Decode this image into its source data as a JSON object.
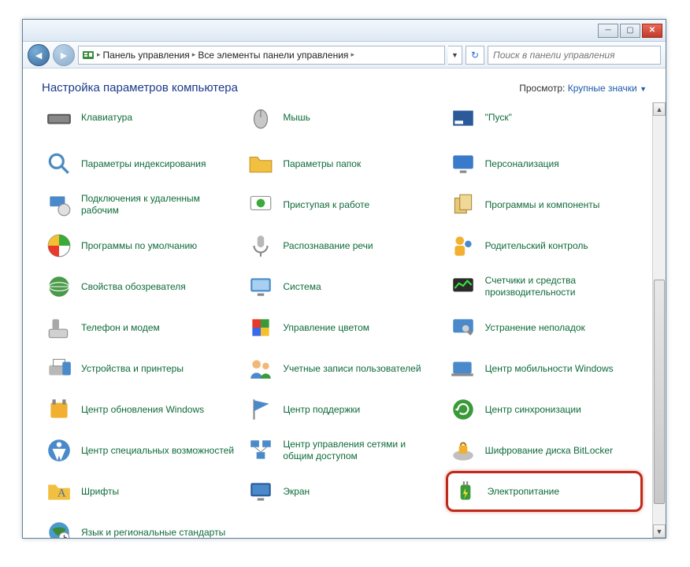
{
  "breadcrumb": {
    "root": "Панель управления",
    "current": "Все элементы панели управления"
  },
  "search": {
    "placeholder": "Поиск в панели управления"
  },
  "header": {
    "title": "Настройка параметров компьютера",
    "view_label": "Просмотр:",
    "view_value": "Крупные значки"
  },
  "items": {
    "r0c0": "Клавиатура",
    "r0c1": "Мышь",
    "r0c2": "\"Пуск\"",
    "r1c0": "Параметры индексирования",
    "r1c1": "Параметры папок",
    "r1c2": "Персонализация",
    "r2c0": "Подключения к удаленным рабочим",
    "r2c1": "Приступая к работе",
    "r2c2": "Программы и компоненты",
    "r3c0": "Программы по умолчанию",
    "r3c1": "Распознавание речи",
    "r3c2": "Родительский контроль",
    "r4c0": "Свойства обозревателя",
    "r4c1": "Система",
    "r4c2": "Счетчики и средства производительности",
    "r5c0": "Телефон и модем",
    "r5c1": "Управление цветом",
    "r5c2": "Устранение неполадок",
    "r6c0": "Устройства и принтеры",
    "r6c1": "Учетные записи пользователей",
    "r6c2": "Центр мобильности Windows",
    "r7c0": "Центр обновления Windows",
    "r7c1": "Центр поддержки",
    "r7c2": "Центр синхронизации",
    "r8c0": "Центр специальных возможностей",
    "r8c1": "Центр управления сетями и общим доступом",
    "r8c2": "Шифрование диска BitLocker",
    "r9c0": "Шрифты",
    "r9c1": "Экран",
    "r9c2": "Электропитание",
    "r10c0": "Язык и региональные стандарты"
  }
}
